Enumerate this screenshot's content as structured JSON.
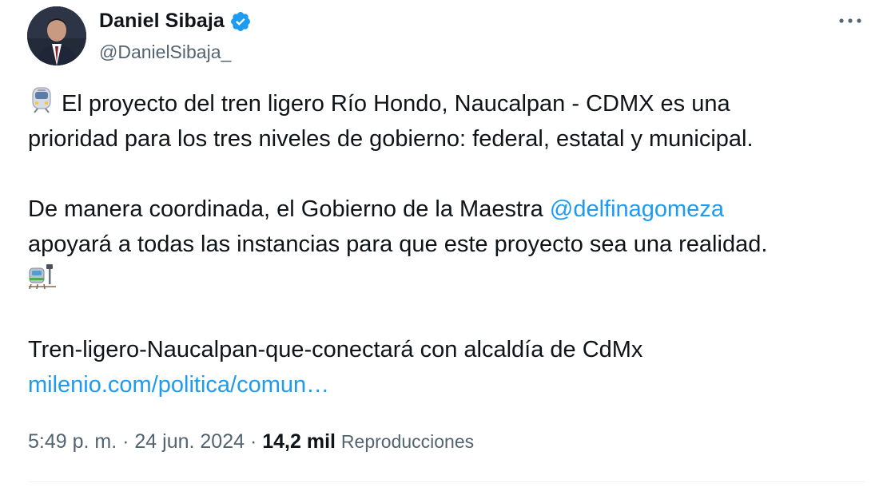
{
  "author": {
    "display_name": "Daniel Sibaja",
    "handle": "@DanielSibaja_",
    "verified": true,
    "avatar_icon": "profile-photo",
    "verified_icon": "verified-badge-icon"
  },
  "menu": {
    "more_icon": "more-horizontal-icon"
  },
  "tweet": {
    "line1_text": "El proyecto del tren ligero Río Hondo, Naucalpan - CDMX es una",
    "line2_text": "prioridad para los tres niveles de gobierno: federal, estatal y municipal.",
    "line4_text": "De manera coordinada, el Gobierno de la Maestra ",
    "mention": "@delfinagomeza",
    "line5_text": "apoyará a todas las instancias para que este proyecto sea una realidad.",
    "line7_text": "Tren-ligero-Naucalpan-que-conectará con alcaldía de CdMx",
    "url_text": "milenio.com/politica/comun…",
    "emoji_1": "light-rail-emoji",
    "emoji_2": "railway-station-emoji"
  },
  "meta": {
    "time": "5:49 p. m.",
    "sep1": " · ",
    "date": "24 jun. 2024",
    "sep2": " · ",
    "views_count": "14,2 mil",
    "views_label": "Reproducciones"
  },
  "colors": {
    "link": "#1d9bf0",
    "text": "#0f1419",
    "secondary": "#536471",
    "verified": "#1d9bf0"
  }
}
